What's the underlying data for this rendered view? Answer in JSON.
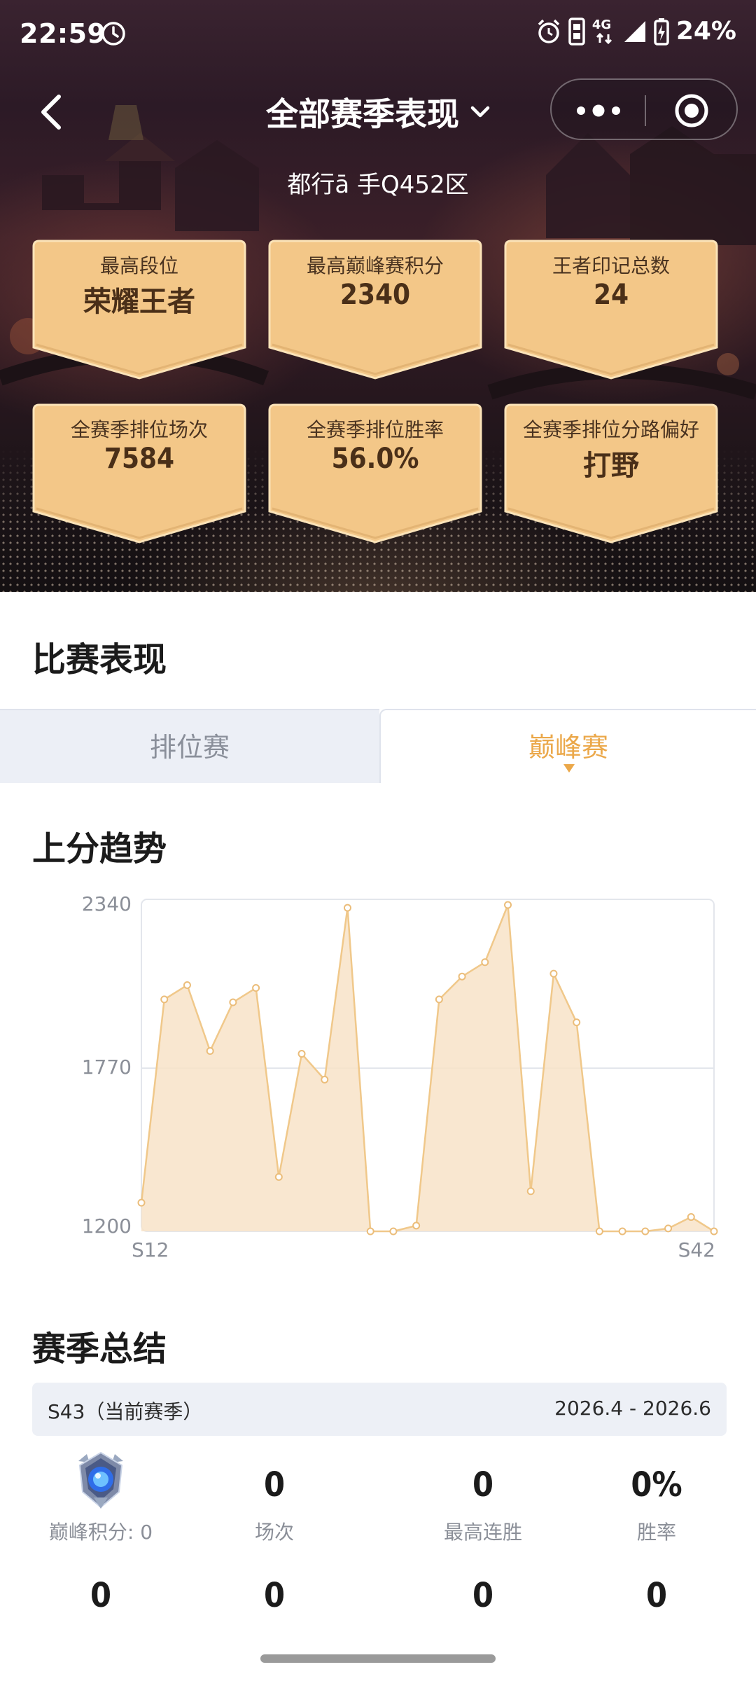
{
  "status_bar": {
    "time": "22:59",
    "network": "4G",
    "battery": "24%"
  },
  "nav": {
    "title": "全部赛季表现",
    "back_icon": "chevron-left-icon",
    "dropdown_icon": "chevron-down-icon",
    "more_icon": "more-dots-icon",
    "close_icon": "target-circle-icon"
  },
  "subtitle": "都行ā 手Q452区",
  "stats": [
    {
      "label": "最高段位",
      "value": "荣耀王者"
    },
    {
      "label": "最高巅峰赛积分",
      "value": "2340"
    },
    {
      "label": "王者印记总数",
      "value": "24"
    },
    {
      "label": "全赛季排位场次",
      "value": "7584"
    },
    {
      "label": "全赛季排位胜率",
      "value": "56.0%"
    },
    {
      "label": "全赛季排位分路偏好",
      "value": "打野"
    }
  ],
  "match_section": {
    "title": "比赛表现",
    "tabs": [
      {
        "label": "排位赛",
        "active": false
      },
      {
        "label": "巅峰赛",
        "active": true
      }
    ]
  },
  "trend_section": {
    "title": "上分趋势"
  },
  "chart_data": {
    "type": "area",
    "title": "上分趋势",
    "xlabel": "",
    "ylabel": "",
    "x_tick_labels": [
      "S12",
      "S42"
    ],
    "y_ticks": [
      1200,
      1770,
      2340
    ],
    "ylim": [
      1200,
      2340
    ],
    "grid": "horizontal line at 1770",
    "color": "#f0c88a",
    "fill": "#f8e3c8",
    "series": [
      {
        "values": [
          1300,
          2010,
          2060,
          1830,
          2000,
          2050,
          1390,
          1820,
          1730,
          2330,
          1200,
          1200,
          1220,
          2010,
          2090,
          2140,
          2340,
          1340,
          2100,
          1930,
          1200,
          1200,
          1200,
          1210,
          1250,
          1200
        ]
      }
    ]
  },
  "summary_section": {
    "title": "赛季总结",
    "season_name": "S43（当前赛季）",
    "season_range": "2026.4 - 2026.6",
    "emblem_icon": "peak-emblem-icon",
    "row1": [
      {
        "label": "巅峰积分: 0"
      },
      {
        "value": "0",
        "label": "场次"
      },
      {
        "value": "0",
        "label": "最高连胜"
      },
      {
        "value": "0%",
        "label": "胜率"
      }
    ],
    "row2": [
      {
        "value": "0"
      },
      {
        "value": "0"
      },
      {
        "value": "0"
      },
      {
        "value": "0"
      }
    ]
  },
  "colors": {
    "accent": "#eba84a",
    "card_gold": "#f3c788",
    "chart_line": "#f0c88a",
    "chart_fill": "#f8e3c8",
    "tab_inactive_bg": "#eceff6"
  }
}
